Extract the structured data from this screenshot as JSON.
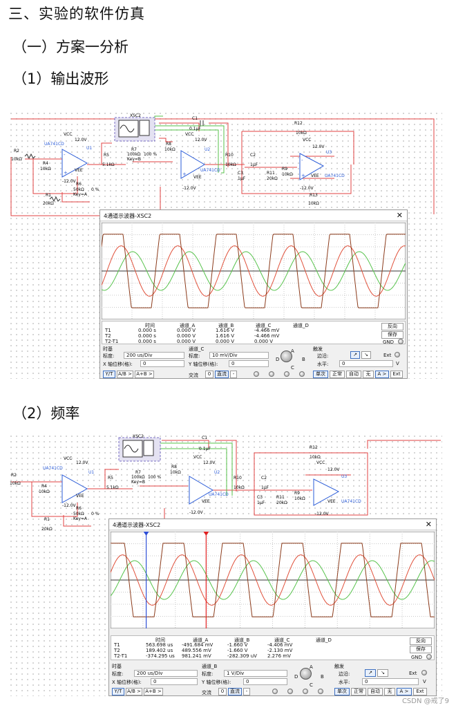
{
  "headings": {
    "section": "三、实验的软件仿真",
    "sub": "（一）方案一分析",
    "item1": "（1）输出波形",
    "item2": "（2）频率"
  },
  "circuit": {
    "components": {
      "xsc": "XSC2",
      "c1": "C1",
      "c1_val": "0.1µF",
      "vcc": "VCC",
      "v12p": "12.0V",
      "v12n": "-12.0V",
      "vee": "VEE",
      "r2": "R2",
      "r2_val": "10kΩ",
      "r4": "R4",
      "r4_val": "10kΩ",
      "r1": "R1",
      "r1_val": "20kΩ",
      "u1_model": "UA741CD",
      "u1": "U1",
      "r5": "R5",
      "r5_val": "5.1kΩ",
      "r7": "R7",
      "r7_val": "100kΩ",
      "r7_pct": "100 %",
      "r7_key": "Key=B",
      "r6": "R6",
      "r6_val": "50kΩ",
      "r6_pct": "0 %",
      "r6_key": "Key=A",
      "r8": "R8",
      "r8_val": "10kΩ",
      "u2_model": "UA741CD",
      "u2": "U2",
      "r10": "R10",
      "r10_val": "10kΩ",
      "c2": "C2",
      "c2_val": "1µF",
      "c3": "C3",
      "c3_val": "1µF",
      "r11": "R11",
      "r11_val": "20kΩ",
      "r9": "R9",
      "r9_val": "10kΩ",
      "r12": "R12",
      "r12_val": "10kΩ",
      "r13": "R13",
      "r13_val": "10kΩ",
      "u3_model": "UA741CD",
      "u3": "U3",
      "plus": "+",
      "minus": "-"
    }
  },
  "oscilloscope_common": {
    "title": "4通道示波器-XSC2",
    "close": "✕",
    "col_time": "时间",
    "col_a": "通道_A",
    "col_b": "通道_B",
    "col_c": "通道_C",
    "col_d": "通道_D",
    "t1": "T1",
    "t2": "T2",
    "t2t1": "T2-T1",
    "reverse": "反向",
    "save": "保存",
    "gnd": "GND",
    "timebase": "时基",
    "scale": "标度:",
    "xpos": "X 轴位移(格):",
    "ypos": "Y 轴位移(格):",
    "yt": "Y/T",
    "ab": "A/B >",
    "apb": "A+B >",
    "ac": "交流",
    "zero": "0",
    "dc": "直流",
    "dash": "-",
    "knob_a": "A",
    "knob_b": "B",
    "knob_c": "C",
    "knob_d": "D",
    "trigger": "触发",
    "edge": "边沿:",
    "level": "水平:",
    "ext": "Ext",
    "volt": "V",
    "single": "单次",
    "normal": "正常",
    "auto": "自动",
    "none": "无",
    "a_sel": "A >",
    "ext_btn": "Ext"
  },
  "oscilloscope1": {
    "rows": [
      [
        "T1",
        "0.000 s",
        "0.000 V",
        "1.616 V",
        "-4.466 mV"
      ],
      [
        "T2",
        "0.000 s",
        "0.000 V",
        "1.616 V",
        "-4.466 mV"
      ],
      [
        "T2-T1",
        "0.000 s",
        "0.000 V",
        "0.000 V",
        "0.000 V"
      ]
    ],
    "timebase_scale": "200 us/Div",
    "x_offset": "0",
    "channel_label": "通道_C",
    "channel_scale": "10 mV/Div",
    "y_offset": "0",
    "trigger_level": "0",
    "traces": {
      "cursors": false,
      "colors": {
        "square": "#8b3a1a",
        "sine_red": "#e0503a",
        "sine_green": "#55c24a"
      }
    }
  },
  "oscilloscope2": {
    "rows": [
      [
        "T1",
        "563.698 us",
        "-491.684 mV",
        "-1.660 V",
        "-4.406 mV"
      ],
      [
        "T2",
        "189.402 us",
        "489.556 mV",
        "-1.660 V",
        "-2.130 mV"
      ],
      [
        "T2-T1",
        "-374.295 us",
        "981.241 mV",
        "-282.309 uV",
        "2.276 mV"
      ]
    ],
    "timebase_scale": "200 us/Div",
    "x_offset": "0",
    "channel_label": "通道_B",
    "channel_scale": "1 V/Div",
    "y_offset": "0",
    "trigger_level": "0",
    "traces": {
      "cursors": true,
      "cursor_colors": {
        "t1": "#2e4fd6",
        "t2": "#e02020"
      }
    }
  },
  "watermark": "CSDN @戒了9"
}
